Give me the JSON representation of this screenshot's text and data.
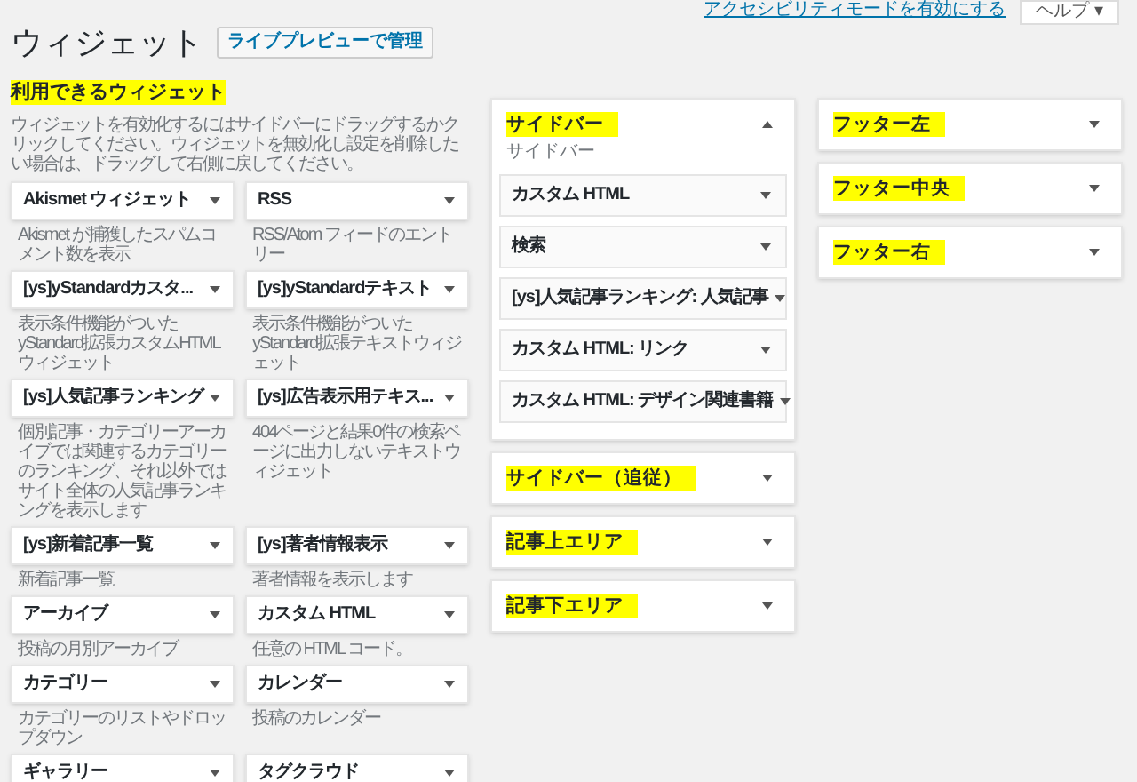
{
  "top_links": {
    "accessibility_link": "アクセシビリティモードを有効にする",
    "help_button": "ヘルプ ▾"
  },
  "page_title": "ウィジェット",
  "manage_button": "ライブプレビューで管理",
  "available": {
    "heading": "利用できるウィジェット",
    "highlighted": true,
    "description": "ウィジェットを有効化するにはサイドバーにドラッグするかクリックしてください。ウィジェットを無効化し設定を削除したい場合は、ドラッグして右側に戻してください。",
    "widgets": [
      {
        "title": "Akismet ウィジェット",
        "description": "Akismet が捕獲したスパムコメント数を表示"
      },
      {
        "title": "RSS",
        "description": "RSS/Atom フィードのエントリー"
      },
      {
        "title": "[ys]yStandardカスタ...",
        "description": "表示条件機能がついたyStandard拡張カスタムHTMLウィジェット"
      },
      {
        "title": "[ys]yStandardテキスト",
        "description": "表示条件機能がついたyStandard拡張テキストウィジェット"
      },
      {
        "title": "[ys]人気記事ランキング",
        "description": "個別記事・カテゴリーアーカイブでは関連するカテゴリーのランキング、それ以外ではサイト全体の人気記事ランキングを表示します"
      },
      {
        "title": "[ys]広告表示用テキス...",
        "description": "404ページと結果0件の検索ページに出力しないテキストウィジェット"
      },
      {
        "title": "[ys]新着記事一覧",
        "description": "新着記事一覧"
      },
      {
        "title": "[ys]著者情報表示",
        "description": "著者情報を表示します"
      },
      {
        "title": "アーカイブ",
        "description": "投稿の月別アーカイブ"
      },
      {
        "title": "カスタム HTML",
        "description": "任意の HTML コード。"
      },
      {
        "title": "カテゴリー",
        "description": "カテゴリーのリストやドロップダウン"
      },
      {
        "title": "カレンダー",
        "description": "投稿のカレンダー"
      },
      {
        "title": "ギャラリー"
      },
      {
        "title": "タグクラウド"
      }
    ]
  },
  "areas_middle": [
    {
      "title": "サイドバー",
      "highlighted": true,
      "expanded": true,
      "description": "サイドバー",
      "widgets": [
        "カスタム HTML",
        "検索",
        "[ys]人気記事ランキング: 人気記事",
        "カスタム HTML: リンク",
        "カスタム HTML: デザイン関連書籍"
      ]
    },
    {
      "title": "サイドバー（追従）",
      "highlighted": true,
      "expanded": false
    },
    {
      "title": "記事上エリア",
      "highlighted": true,
      "expanded": false
    },
    {
      "title": "記事下エリア",
      "highlighted": true,
      "expanded": false
    }
  ],
  "areas_right": [
    {
      "title": "フッター左",
      "highlighted": true,
      "expanded": false
    },
    {
      "title": "フッター中央",
      "highlighted": true,
      "expanded": false
    },
    {
      "title": "フッター右",
      "highlighted": true,
      "expanded": false
    }
  ]
}
